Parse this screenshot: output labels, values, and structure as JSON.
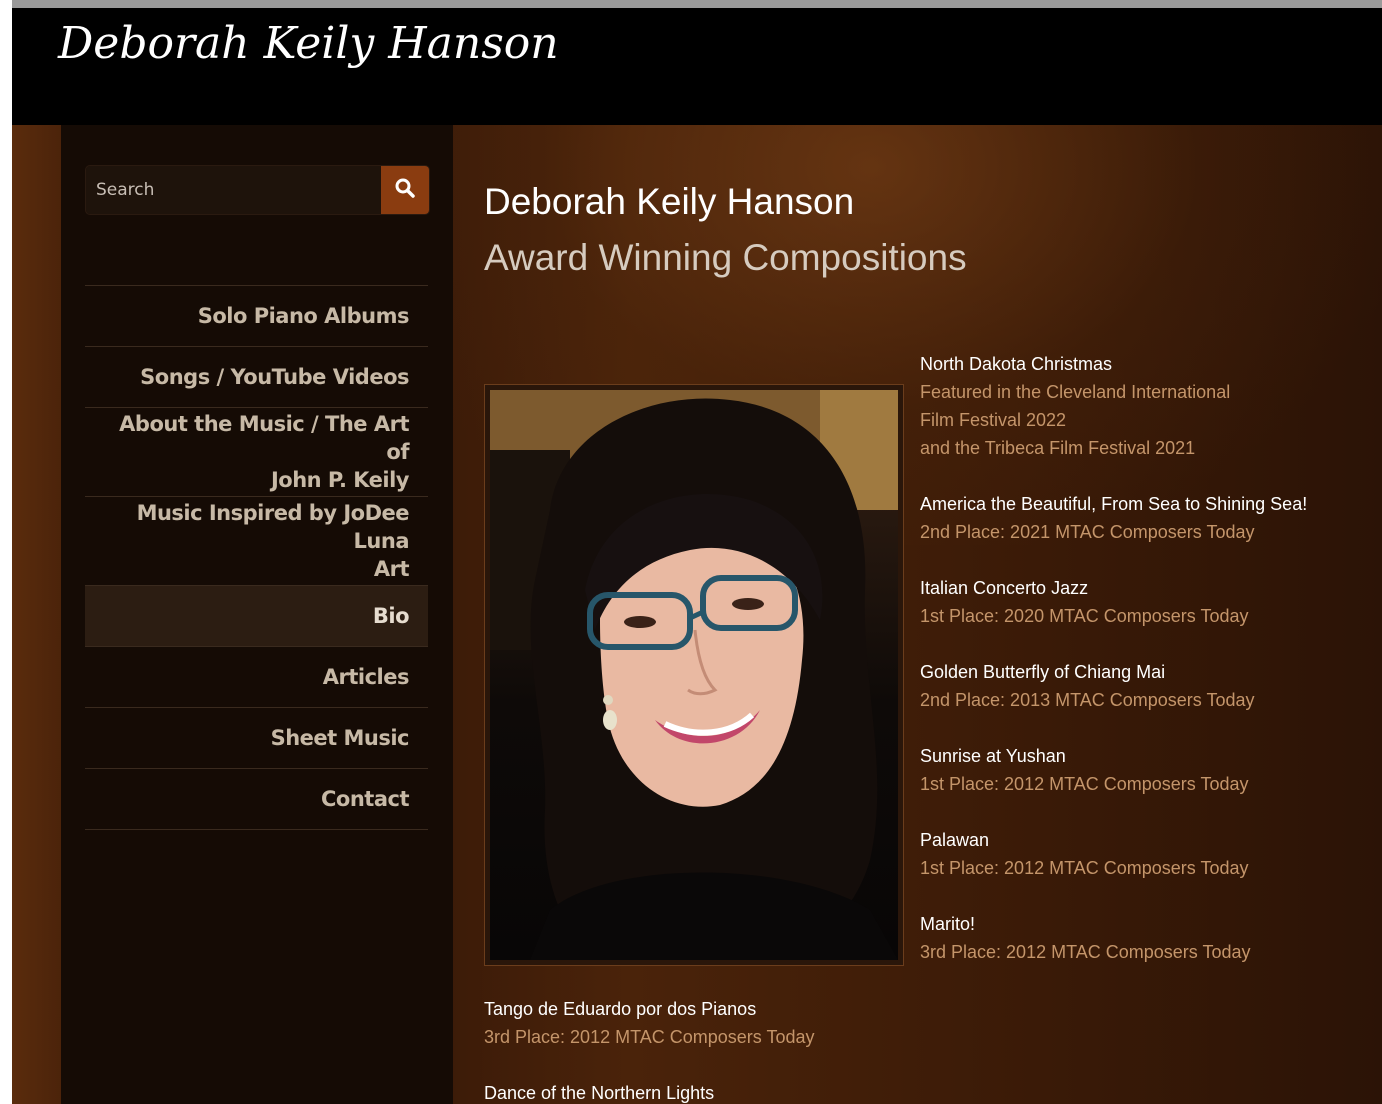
{
  "site": {
    "title": "Deborah Keily Hanson"
  },
  "search": {
    "placeholder": "Search",
    "icon": "search-icon"
  },
  "nav": {
    "items": [
      {
        "label": "Solo Piano Albums"
      },
      {
        "label": "Songs / YouTube Videos"
      },
      {
        "label_line1": "About the Music / The Art of",
        "label_line2": "John P. Keily"
      },
      {
        "label_line1": "Music Inspired by JoDee Luna",
        "label_line2": "Art"
      },
      {
        "label": "Bio",
        "active": true
      },
      {
        "label": "Articles"
      },
      {
        "label": "Sheet Music"
      },
      {
        "label": "Contact"
      }
    ]
  },
  "main": {
    "title": "Deborah Keily Hanson",
    "subtitle": "Award Winning Compositions",
    "awards": [
      {
        "name": "North Dakota Christmas",
        "details": [
          "Featured in the Cleveland International",
          "Film Festival 2022",
          "and the Tribeca Film Festival 2021"
        ]
      },
      {
        "name": "America the Beautiful, From Sea to Shining Sea!",
        "details": [
          "2nd Place: 2021 MTAC Composers Today"
        ]
      },
      {
        "name": "Italian Concerto Jazz",
        "details": [
          "1st Place: 2020 MTAC Composers Today"
        ]
      },
      {
        "name": "Golden Butterfly of Chiang Mai",
        "details": [
          "2nd Place: 2013 MTAC Composers Today"
        ]
      },
      {
        "name": "Sunrise at Yushan",
        "details": [
          "1st Place: 2012 MTAC Composers Today"
        ]
      },
      {
        "name": "Palawan",
        "details": [
          "1st Place: 2012 MTAC Composers Today"
        ]
      },
      {
        "name": "Marito!",
        "details": [
          "3rd Place: 2012 MTAC Composers Today"
        ]
      }
    ],
    "more_awards": [
      {
        "name": "Tango de Eduardo por dos Pianos",
        "details": [
          "3rd Place: 2012 MTAC Composers Today"
        ]
      },
      {
        "name": "Dance of the Northern Lights",
        "details": []
      }
    ]
  },
  "colors": {
    "header_bg": "#000000",
    "sidebar_bg": "#150b05",
    "accent_button": "#8a3c10",
    "award_detail": "#c4956a",
    "nav_text": "#c7b9a6"
  }
}
